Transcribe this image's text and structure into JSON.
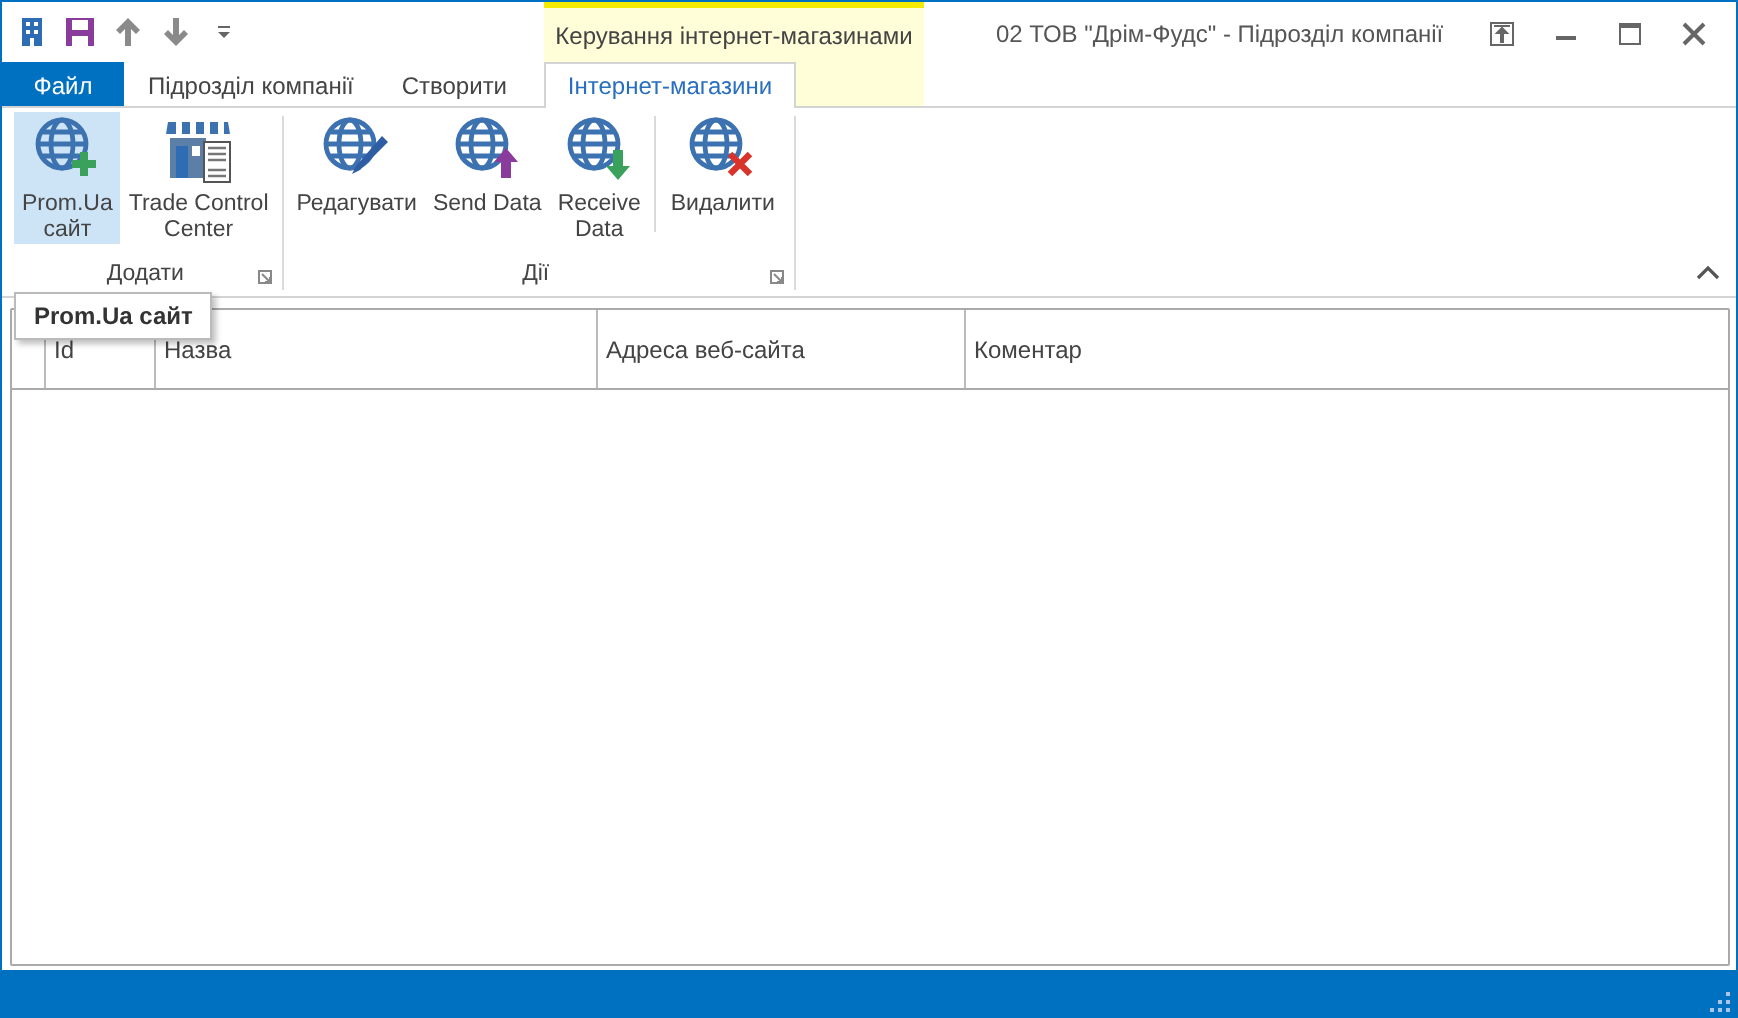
{
  "quick_access": [
    {
      "kind": "building"
    },
    {
      "kind": "save"
    },
    {
      "kind": "up"
    },
    {
      "kind": "down"
    },
    {
      "kind": "customize"
    }
  ],
  "context_tab_group": {
    "label": "Керування інтернет-магазинами"
  },
  "window": {
    "title": "02 ТОВ \"Дрім-Фудс\" - Підрозділ компанії",
    "controls": [
      {
        "kind": "restore-ribbon"
      },
      {
        "kind": "minimize"
      },
      {
        "kind": "maximize"
      },
      {
        "kind": "close"
      }
    ]
  },
  "tabs": [
    {
      "label": "Файл",
      "kind": "file",
      "selected": false
    },
    {
      "label": "Підрозділ компанії",
      "kind": "tab",
      "selected": false
    },
    {
      "label": "Створити",
      "kind": "tab",
      "selected": false
    },
    {
      "label": "Інтернет-магазини",
      "kind": "context",
      "selected": true
    }
  ],
  "ribbon_groups": [
    {
      "label": "Додати",
      "buttons": [
        {
          "label": "Prom.Ua\nсайт",
          "kind": "add",
          "selected": true,
          "separator_before": false
        },
        {
          "label": "Trade Control\nCenter",
          "kind": "store",
          "selected": false,
          "separator_before": false
        }
      ]
    },
    {
      "label": "Дії",
      "buttons": [
        {
          "label": "Редагувати",
          "kind": "edit",
          "selected": false,
          "separator_before": false
        },
        {
          "label": "Send Data",
          "kind": "upload",
          "selected": false,
          "separator_before": false
        },
        {
          "label": "Receive\nData",
          "kind": "download",
          "selected": false,
          "separator_before": false
        },
        {
          "label": "Видалити",
          "kind": "delete",
          "selected": false,
          "separator_before": true
        }
      ]
    }
  ],
  "tooltip": {
    "text": "Prom.Ua сайт"
  },
  "table": {
    "columns": [
      {
        "kind": "indicator"
      },
      {
        "kind": "text",
        "label": "Id"
      },
      {
        "kind": "text",
        "label": "Назва"
      },
      {
        "kind": "text",
        "label": "Адреса веб-сайта"
      },
      {
        "kind": "text",
        "label": "Коментар"
      }
    ]
  }
}
